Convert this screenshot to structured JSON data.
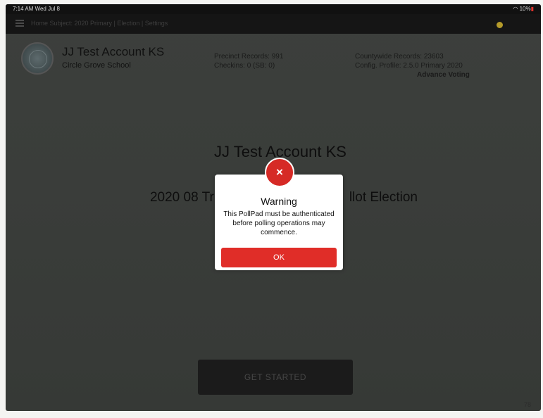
{
  "status_bar": {
    "time_date": "7:14 AM  Wed Jul 8",
    "battery": "10%"
  },
  "nav": {
    "breadcrumb": "Home  Subject: 2020 Primary | Election | Settings"
  },
  "header": {
    "account_name": "JJ Test Account KS",
    "precinct": "Circle Grove School",
    "precinct_records_label": "Precinct Records:",
    "precinct_records_value": "991",
    "checkins_label": "Checkins:",
    "checkins_value": "0 (SB: 0)",
    "countywide_records_label": "Countywide Records:",
    "countywide_records_value": "23603",
    "config_profile_label": "Config. Profile:",
    "config_profile_value": "2.5.0 Primary 2020",
    "voting_mode": "Advance Voting"
  },
  "main": {
    "title": "JJ Test Account KS",
    "election_left": "2020 08 Tr",
    "election_right": "llot Election",
    "get_started_label": "GET STARTED",
    "corner_number": "78"
  },
  "modal": {
    "badge_symbol": "×",
    "title": "Warning",
    "message": "This PollPad must be authenticated before polling operations may commence.",
    "ok_label": "OK"
  },
  "colors": {
    "accent_red": "#e02d28",
    "overlay_dark": "#3a3d3a",
    "nav_bar": "#151515"
  }
}
